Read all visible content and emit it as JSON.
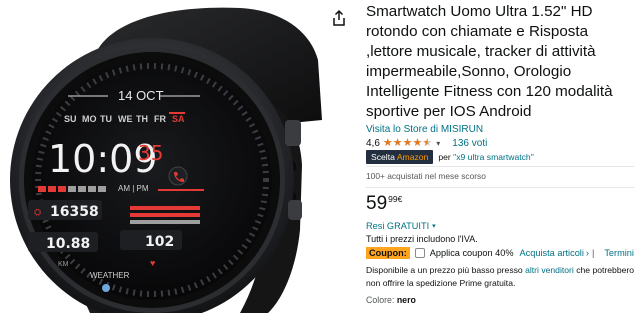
{
  "product_image": {
    "watch_face": {
      "date_text": "14 OCT",
      "weekdays": [
        "SU",
        "MO",
        "TU",
        "WE",
        "TH",
        "FR",
        "SA"
      ],
      "time_text": "10:09",
      "seconds_text": "35",
      "ampm_text": "AM | PM",
      "steps_text": "16358",
      "distance_text": "10.88",
      "heart_text": "102",
      "km_label": "KM",
      "weather_label": "WEATHER"
    },
    "share_icon": "share-icon"
  },
  "product": {
    "title": "Smartwatch Uomo Ultra 1.52\" HD rotondo con chiamate e Risposta ,lettore musicale, tracker di attività impermeabile,Sonno, Orologio Intelligente Fitness con 120 modalità sportive per IOS Android",
    "store_link": "Visita lo Store di MISIRUN",
    "rating_value": "4,6",
    "rating_stars": 4.5,
    "rating_count": "136 voti",
    "choice_badge_prefix": "Scelta",
    "choice_badge_brand": "Amazon",
    "choice_query_prefix": "per",
    "choice_query": "\"x9 ultra smartwatch\"",
    "bought_text": "100+ acquistati nel mese scorso",
    "price_whole": "59",
    "price_fraction": "99",
    "price_symbol": "€",
    "returns_text": "Resi GRATUITI",
    "vat_text": "Tutti i prezzi includono l'IVA.",
    "coupon_label": "Coupon:",
    "coupon_text": "Applica coupon 40%",
    "coupon_shop_link": "Acquista articoli",
    "coupon_shop_chevron": "›",
    "coupon_sep": "|",
    "coupon_terms": "Termini",
    "availability_prefix": "Disponibile a un prezzo più basso presso",
    "availability_link": "altri venditori",
    "availability_suffix": "che potrebbero non offrire la spedizione Prime gratuita.",
    "color_label": "Colore:",
    "color_value": "nero"
  },
  "colors": {
    "link": "#007185",
    "star": "#de7921",
    "coupon": "#ffa41c",
    "choice_bg": "#232f3e",
    "watch_red": "#e53935"
  }
}
